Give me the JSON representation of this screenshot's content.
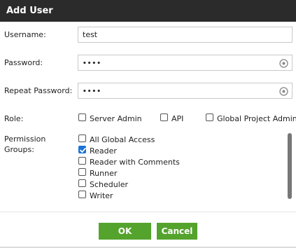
{
  "dialog": {
    "title": "Add User",
    "username_label": "Username:",
    "username_value": "test",
    "password_label": "Password:",
    "password_value": "••••",
    "repeat_password_label": "Repeat Password:",
    "repeat_password_value": "••••",
    "role_label": "Role:",
    "roles": [
      {
        "label": "Server Admin",
        "checked": false
      },
      {
        "label": "API",
        "checked": false
      },
      {
        "label": "Global Project Admin",
        "checked": false
      }
    ],
    "permission_label_line1": "Permission",
    "permission_label_line2": "Groups:",
    "permission_groups": [
      {
        "label": "All Global Access",
        "checked": false
      },
      {
        "label": "Reader",
        "checked": true
      },
      {
        "label": "Reader with Comments",
        "checked": false
      },
      {
        "label": "Runner",
        "checked": false
      },
      {
        "label": "Scheduler",
        "checked": false
      },
      {
        "label": "Writer",
        "checked": false
      }
    ],
    "ok_label": "OK",
    "cancel_label": "Cancel"
  },
  "colors": {
    "titlebar": "#2b2b2b",
    "button": "#54a32d",
    "checkbox_checked": "#1a73d9"
  },
  "icons": {
    "password_reveal": "eye-icon",
    "checkmark": "checkmark-icon"
  }
}
